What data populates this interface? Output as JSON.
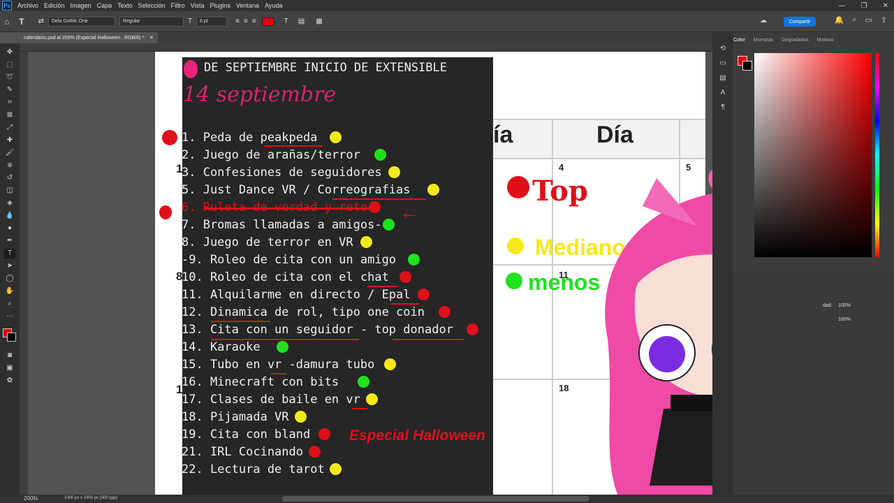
{
  "app": {
    "logo": "Ps"
  },
  "menu": [
    "Archivo",
    "Edición",
    "Imagen",
    "Capa",
    "Texto",
    "Selección",
    "Filtro",
    "Vista",
    "Plugins",
    "Ventana",
    "Ayuda"
  ],
  "options": {
    "font_family": "Dela Gothic One",
    "font_style": "Regular",
    "font_size": "6 pt",
    "text_color": "#e0000f",
    "share_label": "Compartir"
  },
  "document": {
    "tab_title": "calendario.psd al 200% (Especial Halloween , RGB/8) *"
  },
  "panel": {
    "tabs": [
      "Color",
      "Muestras",
      "Degradados",
      "Motivos"
    ],
    "fg_color": "#e0000f",
    "opacity_label": "dad:",
    "opacity_value": "100%",
    "fill_value": "100%"
  },
  "status": {
    "zoom": "200%",
    "doc_size": "1000 px x 1000 px (300 ppp)"
  },
  "canvas": {
    "title": "DE SEPTIEMBRE INICIO DE EXTENSIBLE",
    "subtitle": "14 septiembre",
    "items": [
      {
        "text": "1. Peda de peakpeda",
        "dot": "y"
      },
      {
        "text": "2. Juego de arañas/terror",
        "dot": "g"
      },
      {
        "text": "3. Confesiones  de seguidores",
        "dot": "y"
      },
      {
        "text": "5. Just Dance VR /  Correografias",
        "dot": "y"
      },
      {
        "text": "6. Ruleta de verdad y reto",
        "dot": "r"
      },
      {
        "text": "7. Bromas llamadas a amigos-",
        "dot": "g"
      },
      {
        "text": "8. Juego de terror en VR",
        "dot": "y"
      },
      {
        "text": "-9. Roleo de cita con un amigo",
        "dot": "g"
      },
      {
        "text": "10. Roleo de cita con el chat",
        "dot": "r"
      },
      {
        "text": "11. Alquilarme en directo / Epal",
        "dot": "r"
      },
      {
        "text": "12. Dinamica de rol, tipo one coin",
        "dot": "r"
      },
      {
        "text": "13. Cita con un seguidor - top donador",
        "dot": "r"
      },
      {
        "text": "14. Karaoke",
        "dot": "g"
      },
      {
        "text": "15. Tubo en vr -damura tubo",
        "dot": "y"
      },
      {
        "text": "16. Minecraft con bits",
        "dot": "g"
      },
      {
        "text": "17. Clases de baile en vr",
        "dot": "y"
      },
      {
        "text": "18. Pijamada VR",
        "dot": "y"
      },
      {
        "text": "19. Cita con bland",
        "dot": "r"
      },
      {
        "text": "21. IRL Cocinando",
        "dot": "r"
      },
      {
        "text": "22. Lectura de tarot",
        "dot": "y"
      }
    ],
    "special": "Especial Halloween",
    "calendar": {
      "day_header_1": "ía",
      "day_header_2": "Día",
      "n4": "4",
      "n5": "5",
      "n11": "11",
      "n18": "18",
      "left_1": "1",
      "left_8": "8",
      "left_15": "1"
    },
    "legend": {
      "top": "Top",
      "mid": "Medianos",
      "low": "menos"
    }
  },
  "colors": {
    "yellow": "#f4ea1a",
    "green": "#1ee21e",
    "red": "#e0101a",
    "pink": "#e8257a"
  }
}
